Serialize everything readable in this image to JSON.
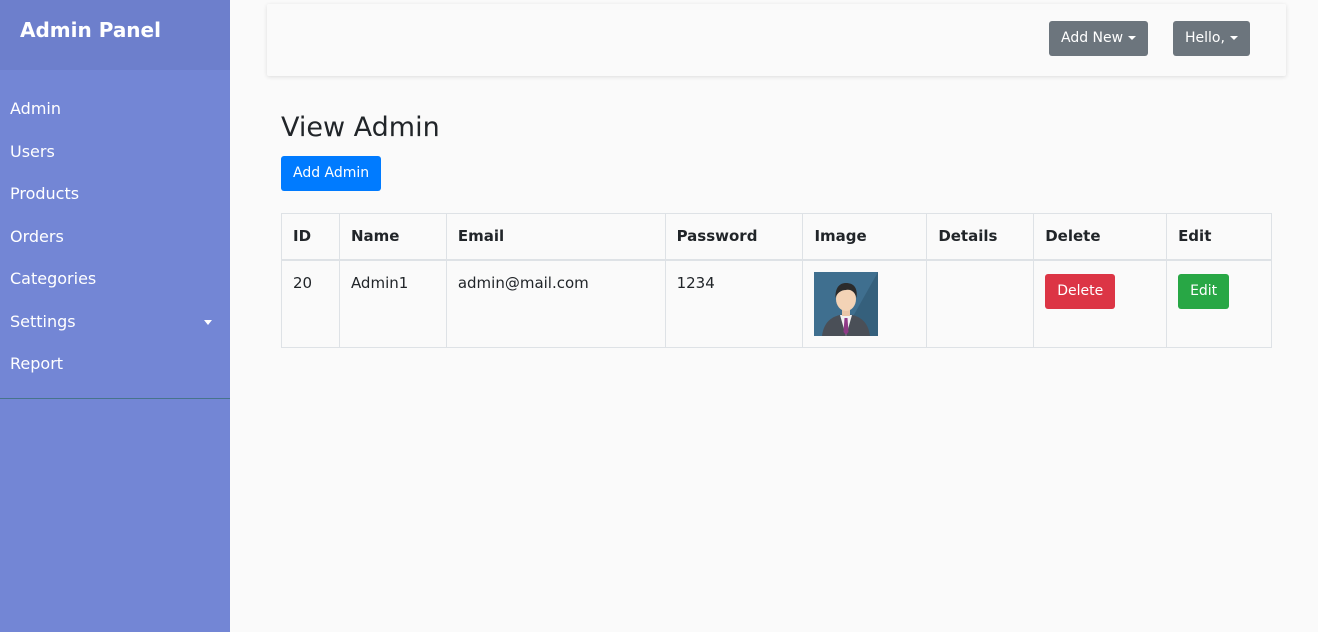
{
  "sidebar": {
    "title": "Admin Panel",
    "items": [
      {
        "label": "Admin"
      },
      {
        "label": "Users"
      },
      {
        "label": "Products"
      },
      {
        "label": "Orders"
      },
      {
        "label": "Categories"
      },
      {
        "label": "Settings",
        "has_caret": true
      },
      {
        "label": "Report"
      }
    ]
  },
  "topbar": {
    "add_new_label": "Add New",
    "user_label": "Hello,"
  },
  "main": {
    "title": "View Admin",
    "add_button_label": "Add Admin",
    "table": {
      "headers": [
        "ID",
        "Name",
        "Email",
        "Password",
        "Image",
        "Details",
        "Delete",
        "Edit"
      ],
      "rows": [
        {
          "id": "20",
          "name": "Admin1",
          "email": "admin@mail.com",
          "password": "1234",
          "details": "",
          "delete_label": "Delete",
          "edit_label": "Edit"
        }
      ]
    }
  },
  "colors": {
    "sidebar_bg": "#7386d5",
    "sidebar_header_bg": "#6d7fcc",
    "primary": "#007bff",
    "danger": "#dc3545",
    "success": "#28a745",
    "secondary": "#6c757d"
  },
  "icons": {
    "dropdown": "caret-down-icon",
    "avatar": "businessman-avatar-image"
  }
}
